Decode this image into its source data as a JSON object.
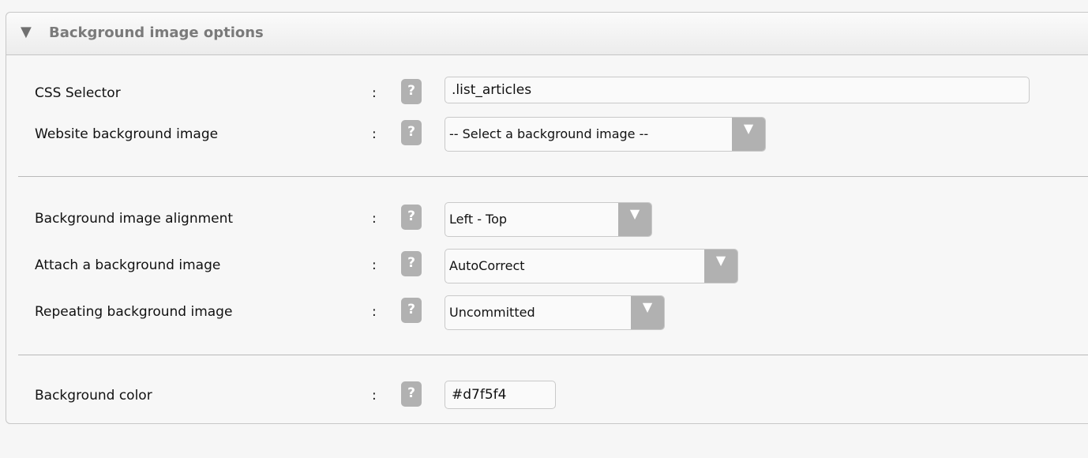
{
  "panel": {
    "title": "Background image options",
    "collapse_icon": "▼"
  },
  "help_glyph": "?",
  "colon": ":",
  "arrow_glyph": "▼",
  "fields": {
    "css_selector": {
      "label": "CSS Selector",
      "value": ".list_articles"
    },
    "website_bg_image": {
      "label": "Website background image",
      "value": "-- Select a background image --"
    },
    "bg_alignment": {
      "label": "Background image alignment",
      "value": "Left - Top"
    },
    "bg_attach": {
      "label": "Attach a background image",
      "value": "AutoCorrect"
    },
    "bg_repeat": {
      "label": "Repeating background image",
      "value": "Uncommitted"
    },
    "bg_color": {
      "label": "Background color",
      "value": "#d7f5f4"
    }
  }
}
